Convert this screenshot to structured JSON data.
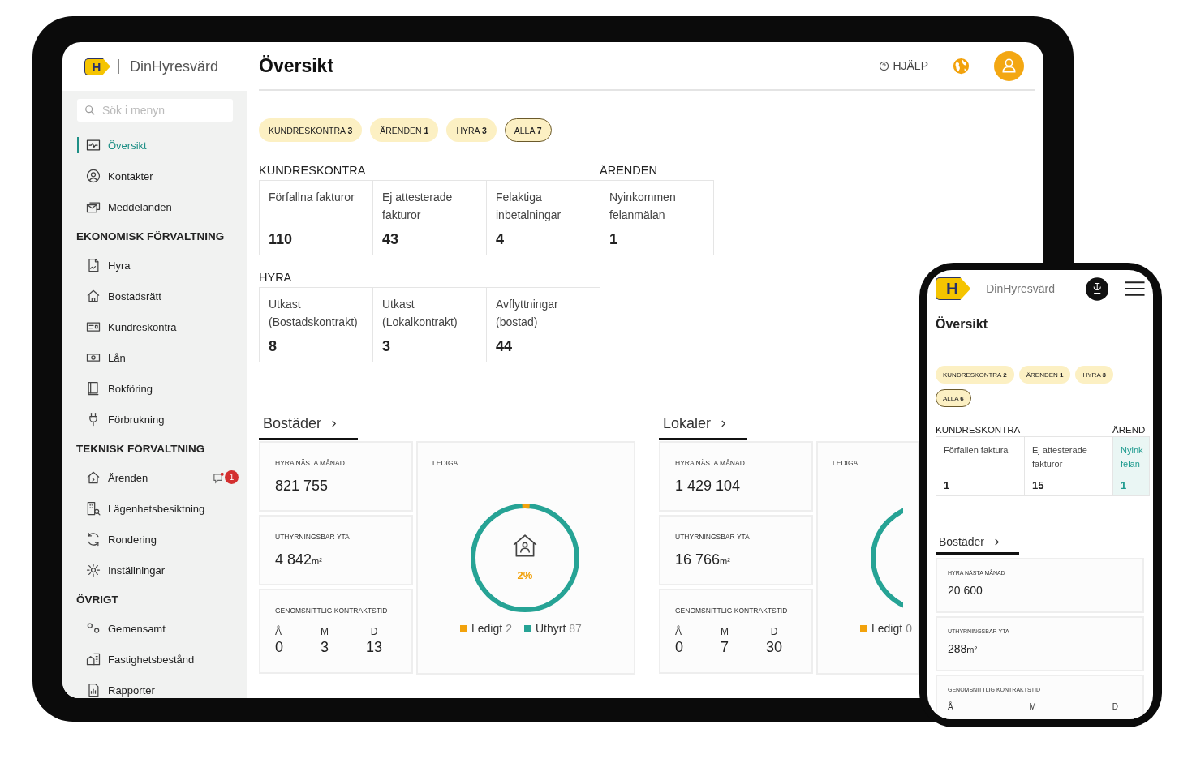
{
  "tablet": {
    "logo_mark": "H",
    "brand": "DinHyresvärd",
    "title": "Översikt",
    "help": "HJÄLP",
    "search": {
      "placeholder": "Sök i menyn"
    },
    "sidebar": [
      {
        "items": [
          {
            "label": "Översikt",
            "selected": true
          },
          {
            "label": "Kontakter",
            "selected": false
          },
          {
            "label": "Meddelanden",
            "selected": false
          }
        ]
      },
      {
        "heading": "EKONOMISK FÖRVALTNING",
        "items": [
          {
            "label": "Hyra",
            "selected": false
          },
          {
            "label": "Bostadsrätt",
            "selected": false
          },
          {
            "label": "Kundreskontra",
            "selected": false
          },
          {
            "label": "Lån",
            "selected": false
          },
          {
            "label": "Bokföring",
            "selected": false
          },
          {
            "label": "Förbrukning",
            "selected": false
          }
        ]
      },
      {
        "heading": "TEKNISK FÖRVALTNING",
        "items": [
          {
            "label": "Ärenden",
            "selected": false,
            "badge": "1"
          },
          {
            "label": "Lägenhetsbesiktning",
            "selected": false
          },
          {
            "label": "Rondering",
            "selected": false
          },
          {
            "label": "Inställningar",
            "selected": false
          }
        ]
      },
      {
        "heading": "ÖVRIGT",
        "items": [
          {
            "label": "Gemensamt",
            "selected": false
          },
          {
            "label": "Fastighetsbestånd",
            "selected": false
          },
          {
            "label": "Rapporter",
            "selected": false
          }
        ]
      }
    ],
    "filters": [
      {
        "label": "KUNDRESKONTRA",
        "count": "3",
        "selected": false
      },
      {
        "label": "ÄRENDEN",
        "count": "1",
        "selected": false
      },
      {
        "label": "HYRA",
        "count": "3",
        "selected": false
      },
      {
        "label": "ALLA",
        "count": "7",
        "selected": true
      }
    ],
    "stat_rows": [
      [
        {
          "title": "KUNDRESKONTRA",
          "cards": [
            {
              "label": "Förfallna fakturor",
              "value": "110",
              "highlighted": false
            },
            {
              "label": "Ej attesterade fakturor",
              "value": "43",
              "highlighted": false
            },
            {
              "label": "Felaktiga inbetalningar",
              "value": "4",
              "highlighted": false
            }
          ]
        },
        {
          "title": "ÄRENDEN",
          "cards": [
            {
              "label": "Nyinkommen felanmälan",
              "value": "1",
              "highlighted": false
            }
          ]
        }
      ],
      [
        {
          "title": "HYRA",
          "cards": [
            {
              "label": "Utkast (Bostadskontrakt)",
              "value": "8",
              "highlighted": false
            },
            {
              "label": "Utkast (Lokalkontrakt)",
              "value": "3",
              "highlighted": false
            },
            {
              "label": "Avflyttningar (bostad)",
              "value": "44",
              "highlighted": false
            }
          ]
        }
      ]
    ],
    "sections": [
      {
        "title": "Bostäder",
        "rent": {
          "label": "HYRA NÄSTA MÅNAD",
          "value": "821 755"
        },
        "area": {
          "label": "UTHYRNINGSBAR YTA",
          "value": "4 842",
          "unit": "m²"
        },
        "duration": {
          "label": "GENOMSNITTLIG KONTRAKTSTID",
          "columns": [
            {
              "head": "Å",
              "value": "0"
            },
            {
              "head": "M",
              "value": "3"
            },
            {
              "head": "D",
              "value": "13"
            }
          ]
        },
        "vacancy": {
          "label": "LEDIGA",
          "percent": "2%",
          "legend": [
            {
              "label": "Ledigt",
              "count": "2",
              "color": "#f2a20c"
            },
            {
              "label": "Uthyrt",
              "count": "87",
              "color": "#26a395"
            }
          ]
        }
      },
      {
        "title": "Lokaler",
        "rent": {
          "label": "HYRA NÄSTA MÅNAD",
          "value": "1 429 104"
        },
        "area": {
          "label": "UTHYRNINGSBAR YTA",
          "value": "16 766",
          "unit": "m²"
        },
        "duration": {
          "label": "GENOMSNITTLIG KONTRAKTSTID",
          "columns": [
            {
              "head": "Å",
              "value": "0"
            },
            {
              "head": "M",
              "value": "7"
            },
            {
              "head": "D",
              "value": "30"
            }
          ]
        },
        "vacancy": {
          "label": "LEDIGA",
          "legend": [
            {
              "label": "Ledigt",
              "count": "0",
              "color": "#f2a20c"
            }
          ]
        }
      }
    ]
  },
  "phone": {
    "logo_mark": "H",
    "brand": "DinHyresvärd",
    "title": "Översikt",
    "filters": [
      {
        "label": "KUNDRESKONTRA",
        "count": "2",
        "selected": false
      },
      {
        "label": "ÄRENDEN",
        "count": "1",
        "selected": false
      },
      {
        "label": "HYRA",
        "count": "3",
        "selected": false
      },
      {
        "label": "ALLA",
        "count": "6",
        "selected": true
      }
    ],
    "stat_groups": [
      {
        "title": "KUNDRESKONTRA",
        "cards": [
          {
            "label": "Förfallen faktura",
            "value": "1",
            "highlighted": false
          },
          {
            "label": "Ej attesterade fakturor",
            "value": "15",
            "highlighted": false
          }
        ]
      },
      {
        "title": "ÄREND",
        "cards": [
          {
            "label": "Nyink felan",
            "value": "1",
            "highlighted": true
          }
        ]
      }
    ],
    "section": {
      "title": "Bostäder",
      "rent": {
        "label": "HYRA NÄSTA MÅNAD",
        "value": "20 600"
      },
      "area": {
        "label": "UTHYRNINGSBAR YTA",
        "value": "288",
        "unit": "m²"
      },
      "duration": {
        "label": "GENOMSNITTLIG KONTRAKTSTID",
        "columns": [
          {
            "head": "Å"
          },
          {
            "head": "M"
          },
          {
            "head": "D"
          }
        ]
      }
    }
  }
}
